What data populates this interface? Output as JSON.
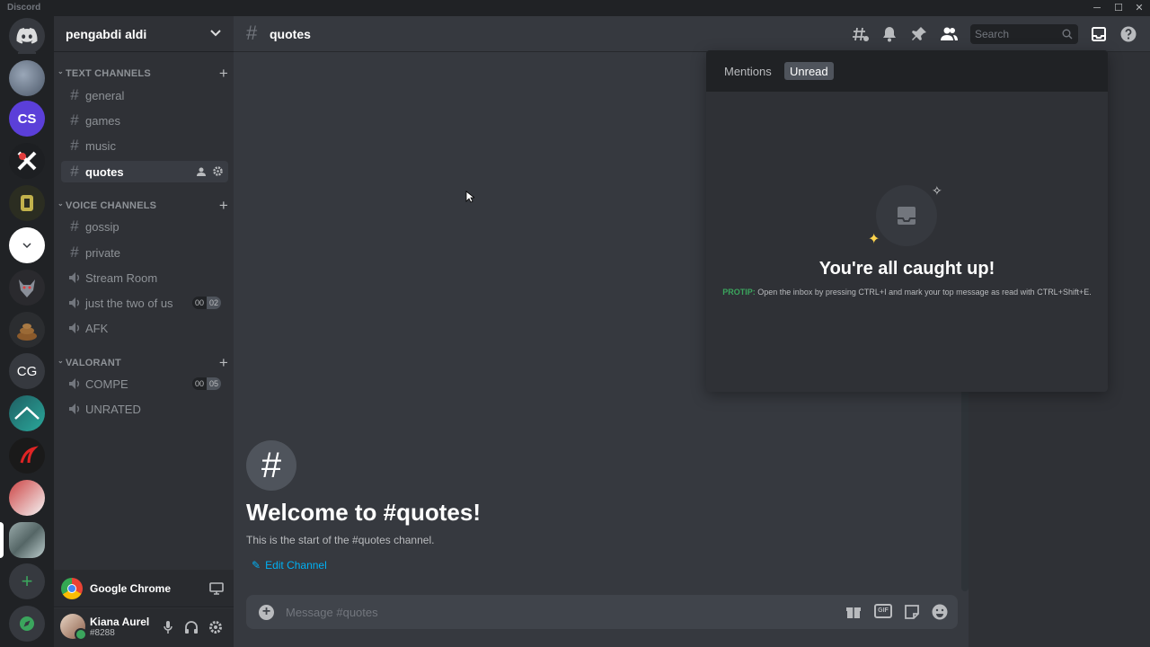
{
  "window": {
    "title": "Discord",
    "minimize": "─",
    "maximize": "☐",
    "close": "✕"
  },
  "rail": {
    "add_label": "+",
    "cg_label": "CG",
    "cs_label": "CS"
  },
  "guild": {
    "name": "pengabdi aldi"
  },
  "categories": {
    "text": "TEXT CHANNELS",
    "voice": "VOICE CHANNELS",
    "valorant": "VALORANT"
  },
  "text_channels": [
    "general",
    "games",
    "music",
    "quotes"
  ],
  "voice_channels": [
    {
      "name": "gossip",
      "type": "text"
    },
    {
      "name": "private",
      "type": "text"
    },
    {
      "name": "Stream Room",
      "type": "voice"
    },
    {
      "name": "just the two of us",
      "type": "voice",
      "count_a": "00",
      "count_b": "02"
    },
    {
      "name": "AFK",
      "type": "voice"
    }
  ],
  "valorant_channels": [
    {
      "name": "COMPE",
      "count_a": "00",
      "count_b": "05"
    },
    {
      "name": "UNRATED"
    }
  ],
  "activity": {
    "name": "Google Chrome"
  },
  "user": {
    "name": "Kiana Aurel",
    "tag": "#8288"
  },
  "channel": {
    "title": "quotes"
  },
  "search": {
    "placeholder": "Search"
  },
  "welcome": {
    "title": "Welcome to #quotes!",
    "subtitle": "This is the start of the #quotes channel.",
    "edit": "Edit Channel"
  },
  "composer": {
    "placeholder": "Message #quotes",
    "gif": "GIF"
  },
  "inbox": {
    "tab_mentions": "Mentions",
    "tab_unread": "Unread",
    "caught_up": "You're all caught up!",
    "protip_label": "PROTIP:",
    "protip_text": " Open the inbox by pressing CTRL+I and mark your top message as read with CTRL+Shift+E."
  },
  "colors": {
    "accent": "#5865f2",
    "link": "#00b0f4",
    "online": "#3ba55d",
    "protip": "#3ba55d"
  }
}
